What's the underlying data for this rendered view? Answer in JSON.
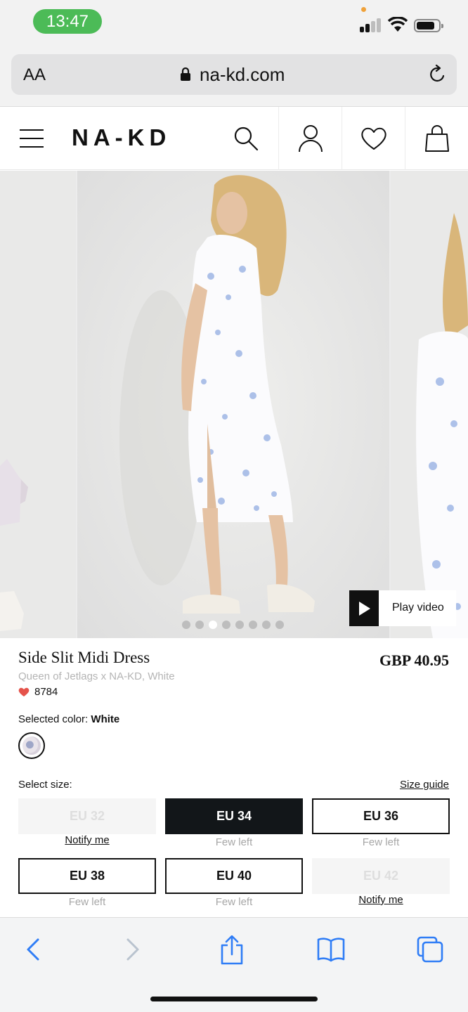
{
  "status_bar": {
    "time": "13:47"
  },
  "browser": {
    "text_size_label": "AA",
    "domain": "na-kd.com"
  },
  "site": {
    "logo": "NA-KD"
  },
  "gallery": {
    "video_label": "Play video",
    "dot_count": 8,
    "active_dot": 2
  },
  "product": {
    "title": "Side Slit Midi Dress",
    "price": "GBP 40.95",
    "subtitle": "Queen of Jetlags x NA-KD, White",
    "likes": "8784",
    "color_label": "Selected color:",
    "color_value": "White",
    "size_label": "Select size:",
    "size_guide": "Size guide"
  },
  "sizes": [
    {
      "label": "EU 32",
      "note": "Notify me"
    },
    {
      "label": "EU 34",
      "note": "Few left"
    },
    {
      "label": "EU 36",
      "note": "Few left"
    },
    {
      "label": "EU 38",
      "note": "Few left"
    },
    {
      "label": "EU 40",
      "note": "Few left"
    },
    {
      "label": "EU 42",
      "note": "Notify me"
    }
  ],
  "colors": {
    "status_green": "#4cbb57",
    "ios_blue": "#2f7df6",
    "like_red": "#e5534b",
    "selected_size_bg": "#121619"
  }
}
